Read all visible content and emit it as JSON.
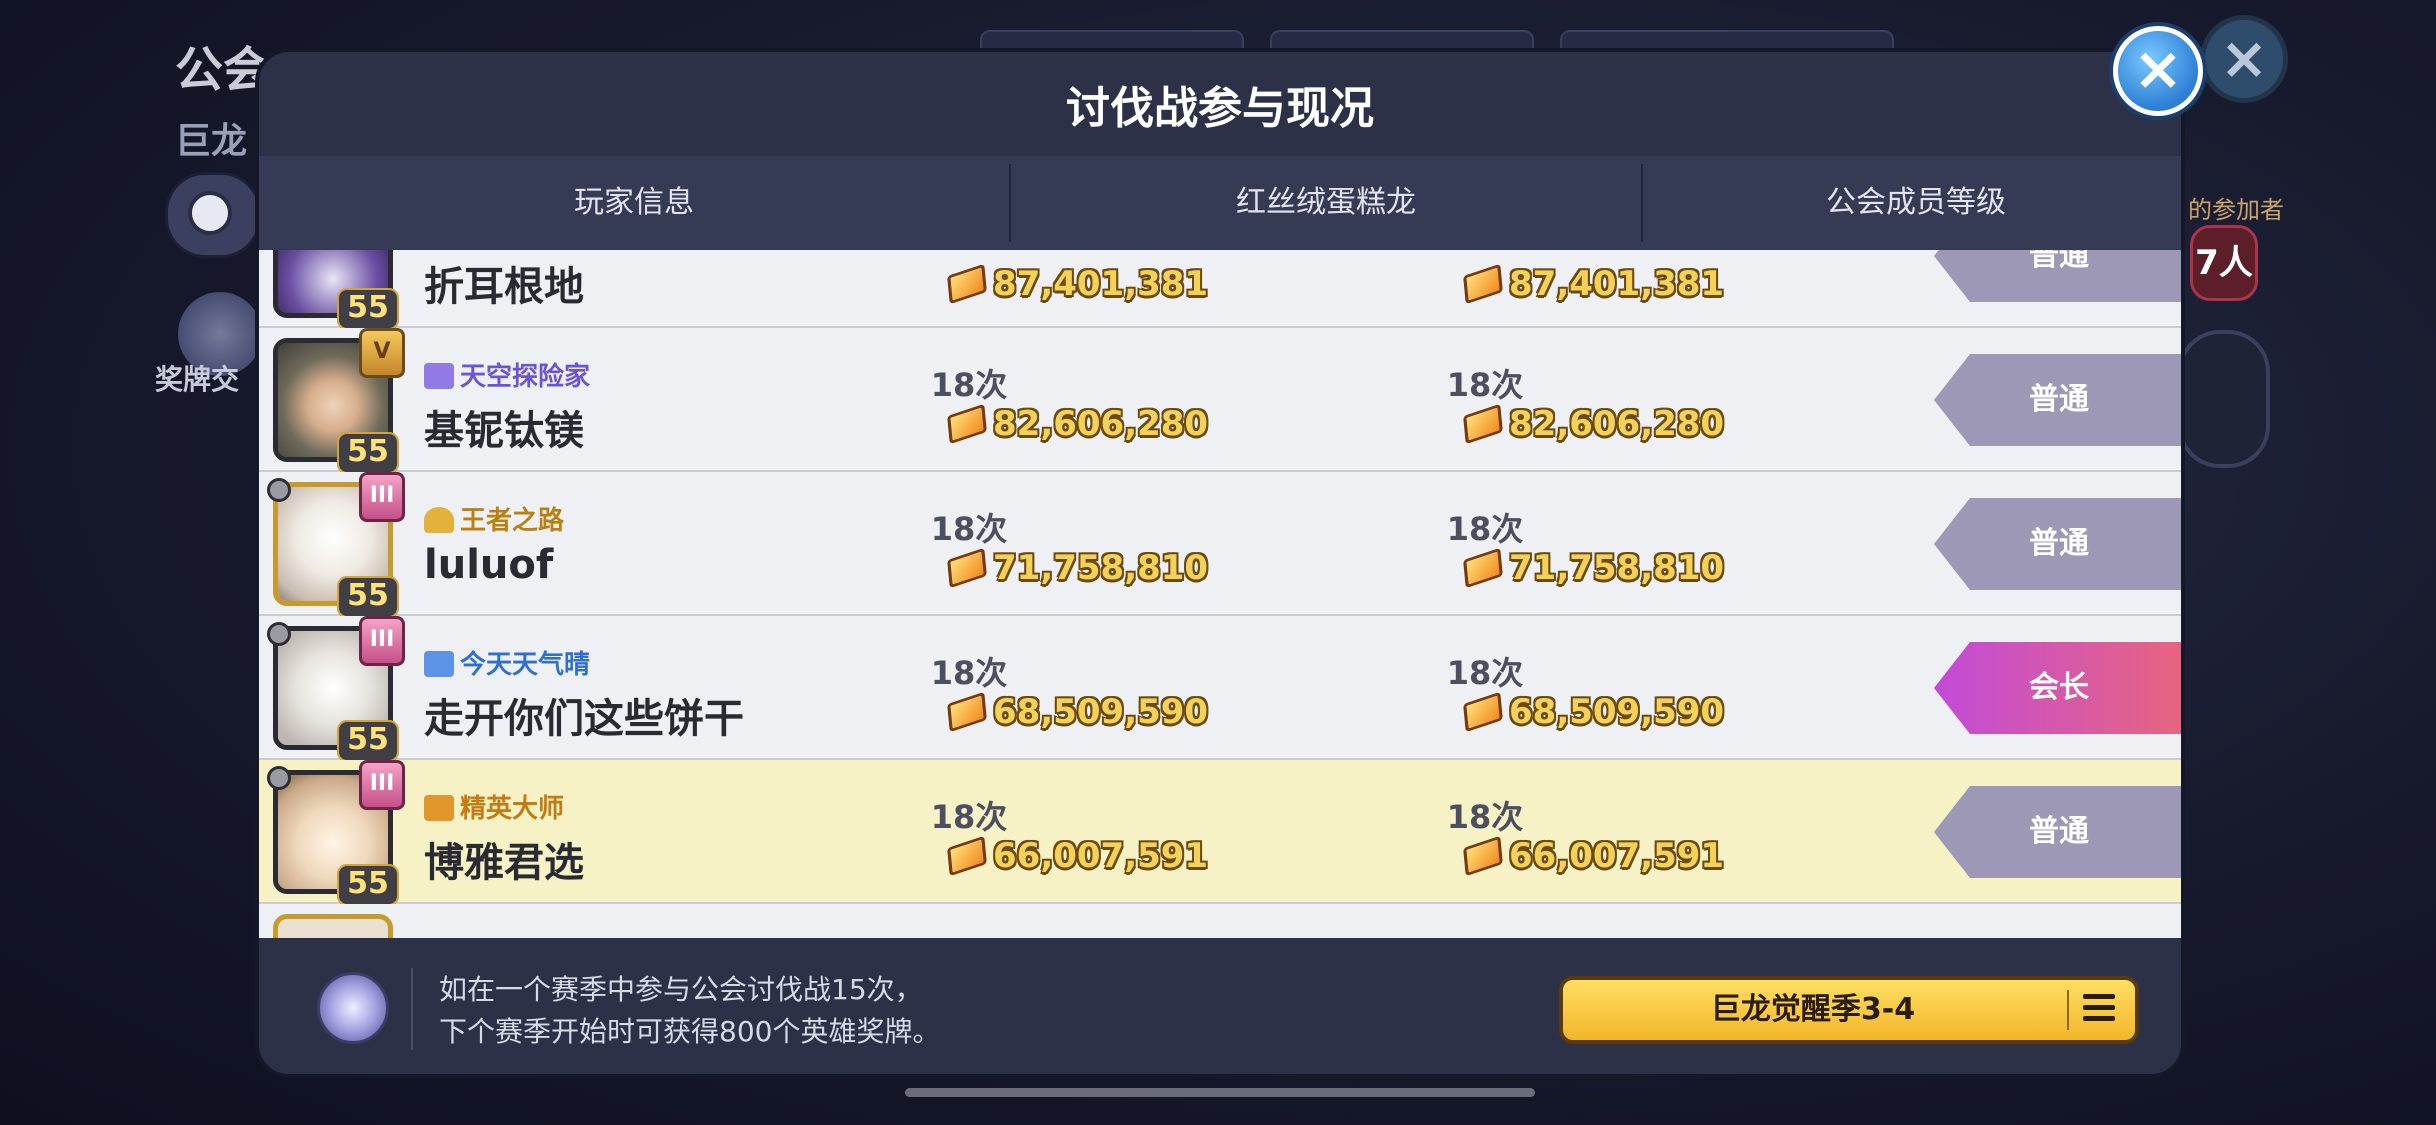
{
  "background": {
    "title": "公会",
    "subtitle": "巨龙",
    "medal_label": "奖牌交",
    "participants_label": "的参加者",
    "participants_count": "7人"
  },
  "modal": {
    "title": "讨伐战参与现况",
    "columns": [
      "玩家信息",
      "红丝绒蛋糕龙",
      "公会成员等级"
    ],
    "rows": [
      {
        "name": "折耳根地",
        "title": "",
        "level": "55",
        "count_a": "",
        "score_a": "87,401,381",
        "count_b": "",
        "score_b": "87,401,381",
        "grade": "普通"
      },
      {
        "name": "基铌钛镁",
        "title": "天空探险家",
        "level": "55",
        "count_a": "18次",
        "score_a": "82,606,280",
        "count_b": "18次",
        "score_b": "82,606,280",
        "grade": "普通"
      },
      {
        "name": "luluof",
        "title": "王者之路",
        "level": "55",
        "count_a": "18次",
        "score_a": "71,758,810",
        "count_b": "18次",
        "score_b": "71,758,810",
        "grade": "普通"
      },
      {
        "name": "走开你们这些饼干",
        "title": "今天天气晴",
        "level": "55",
        "count_a": "18次",
        "score_a": "68,509,590",
        "count_b": "18次",
        "score_b": "68,509,590",
        "grade": "会长"
      },
      {
        "name": "博雅君选",
        "title": "精英大师",
        "level": "55",
        "count_a": "18次",
        "score_a": "66,007,591",
        "count_b": "18次",
        "score_b": "66,007,591",
        "grade": "普通"
      }
    ],
    "footer": {
      "line1": "如在一个赛季中参与公会讨伐战15次，",
      "line2": "下个赛季开始时可获得800个英雄奖牌。",
      "season_button": "巨龙觉醒季3-4"
    },
    "close_icon": "×"
  },
  "colors": {
    "title_sky": "#6b54d6",
    "title_king": "#b98012",
    "title_weather": "#2f6fd0",
    "title_elite": "#c57a12"
  }
}
